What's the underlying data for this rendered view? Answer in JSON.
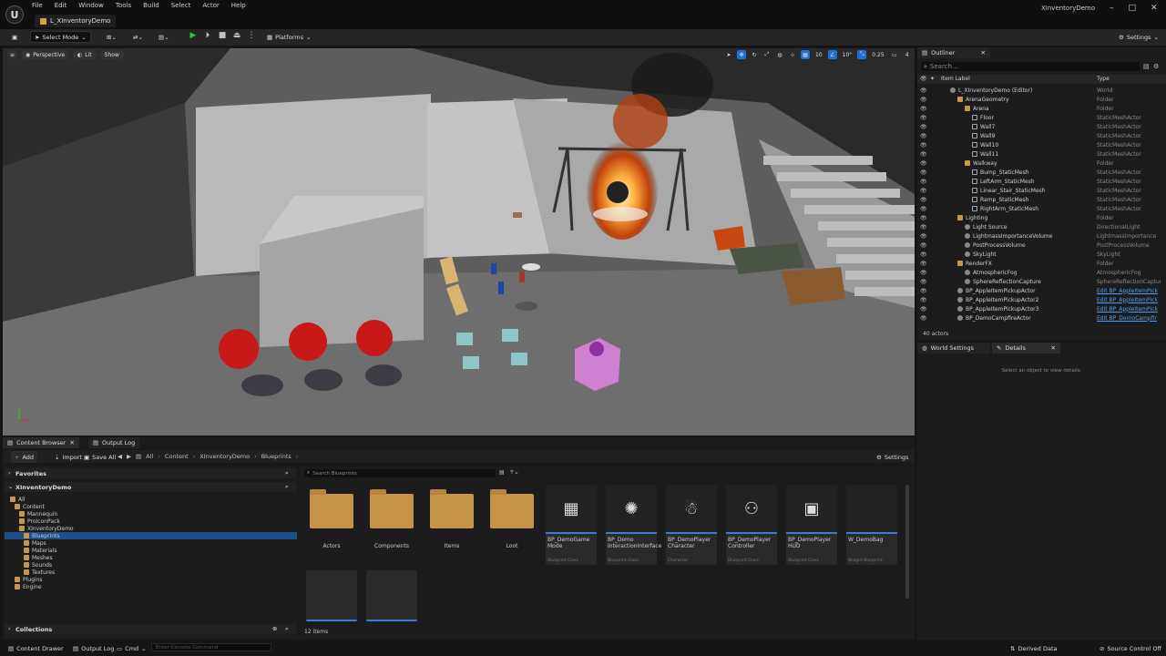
{
  "app": {
    "project": "XInventoryDemo",
    "level_tab": "L_XInventoryDemo"
  },
  "menu": [
    "File",
    "Edit",
    "Window",
    "Tools",
    "Build",
    "Select",
    "Actor",
    "Help"
  ],
  "toolbar": {
    "select_mode": "Select Mode",
    "platforms": "Platforms",
    "settings": "Settings"
  },
  "viewport": {
    "perspective": "Perspective",
    "lit": "Lit",
    "show": "Show",
    "grid_snap": "10",
    "rot_snap": "10°",
    "scale_snap": "0.25",
    "cam_speed": "4"
  },
  "outliner": {
    "tab": "Outliner",
    "search_placeholder": "Search...",
    "col_label": "Item Label",
    "col_type": "Type",
    "rows": [
      {
        "label": "L_XInventoryDemo (Editor)",
        "type": "World",
        "indent": 0,
        "icon": "actor"
      },
      {
        "label": "ArenaGeometry",
        "type": "Folder",
        "indent": 1,
        "icon": "folder"
      },
      {
        "label": "Arena",
        "type": "Folder",
        "indent": 2,
        "icon": "folder"
      },
      {
        "label": "Floor",
        "type": "StaticMeshActor",
        "indent": 3,
        "icon": "mesh"
      },
      {
        "label": "Wall7",
        "type": "StaticMeshActor",
        "indent": 3,
        "icon": "mesh"
      },
      {
        "label": "Wall9",
        "type": "StaticMeshActor",
        "indent": 3,
        "icon": "mesh"
      },
      {
        "label": "Wall10",
        "type": "StaticMeshActor",
        "indent": 3,
        "icon": "mesh"
      },
      {
        "label": "Wall11",
        "type": "StaticMeshActor",
        "indent": 3,
        "icon": "mesh"
      },
      {
        "label": "Walkway",
        "type": "Folder",
        "indent": 2,
        "icon": "folder"
      },
      {
        "label": "Bump_StaticMesh",
        "type": "StaticMeshActor",
        "indent": 3,
        "icon": "mesh"
      },
      {
        "label": "LeftArm_StaticMesh",
        "type": "StaticMeshActor",
        "indent": 3,
        "icon": "mesh"
      },
      {
        "label": "Linear_Stair_StaticMesh",
        "type": "StaticMeshActor",
        "indent": 3,
        "icon": "mesh"
      },
      {
        "label": "Ramp_StaticMesh",
        "type": "StaticMeshActor",
        "indent": 3,
        "icon": "mesh"
      },
      {
        "label": "RightArm_StaticMesh",
        "type": "StaticMeshActor",
        "indent": 3,
        "icon": "mesh"
      },
      {
        "label": "Lighting",
        "type": "Folder",
        "indent": 1,
        "icon": "folder"
      },
      {
        "label": "Light Source",
        "type": "DirectionalLight",
        "indent": 2,
        "icon": "actor"
      },
      {
        "label": "LightmassImportanceVolume",
        "type": "LightmassImportance",
        "indent": 2,
        "icon": "actor"
      },
      {
        "label": "PostProcessVolume",
        "type": "PostProcessVolume",
        "indent": 2,
        "icon": "actor"
      },
      {
        "label": "SkyLight",
        "type": "SkyLight",
        "indent": 2,
        "icon": "actor"
      },
      {
        "label": "RenderFX",
        "type": "Folder",
        "indent": 1,
        "icon": "folder"
      },
      {
        "label": "AtmosphericFog",
        "type": "AtmosphericFog",
        "indent": 2,
        "icon": "actor"
      },
      {
        "label": "SphereReflectionCapture",
        "type": "SphereReflectionCapture",
        "indent": 2,
        "icon": "actor"
      },
      {
        "label": "BP_AppleItemPickupActor",
        "type": "Edit BP_AppleItemPick",
        "indent": 1,
        "icon": "actor",
        "link": true
      },
      {
        "label": "BP_AppleItemPickupActor2",
        "type": "Edit BP_AppleItemPick",
        "indent": 1,
        "icon": "actor",
        "link": true
      },
      {
        "label": "BP_AppleItemPickupActor3",
        "type": "Edit BP_AppleItemPick",
        "indent": 1,
        "icon": "actor",
        "link": true
      },
      {
        "label": "BP_DemoCampfireActor",
        "type": "Edit BP_DemoCampfir",
        "indent": 1,
        "icon": "actor",
        "link": true
      }
    ],
    "count": "40 actors"
  },
  "details": {
    "tab_world": "World Settings",
    "tab_details": "Details",
    "empty": "Select an object to view details."
  },
  "content_browser": {
    "tab": "Content Browser",
    "tab_output": "Output Log",
    "add": "Add",
    "import": "Import",
    "save_all": "Save All",
    "path": [
      "All",
      "Content",
      "XInventoryDemo",
      "Blueprints"
    ],
    "settings": "Settings",
    "favorites": "Favorites",
    "root": "XInventoryDemo",
    "search_placeholder": "Search Blueprints",
    "tree": [
      {
        "label": "All",
        "indent": 0
      },
      {
        "label": "Content",
        "indent": 1
      },
      {
        "label": "Mannequin",
        "indent": 2
      },
      {
        "label": "ProIconPack",
        "indent": 2
      },
      {
        "label": "XInventoryDemo",
        "indent": 2
      },
      {
        "label": "Blueprints",
        "indent": 3,
        "selected": true
      },
      {
        "label": "Maps",
        "indent": 3
      },
      {
        "label": "Materials",
        "indent": 3
      },
      {
        "label": "Meshes",
        "indent": 3
      },
      {
        "label": "Sounds",
        "indent": 3
      },
      {
        "label": "Textures",
        "indent": 3
      },
      {
        "label": "Plugins",
        "indent": 1
      },
      {
        "label": "Engine",
        "indent": 1
      }
    ],
    "folders": [
      "Actors",
      "Components",
      "Items",
      "Loot"
    ],
    "assets": [
      {
        "name": "BP_DemoGame Mode",
        "sub": "Blueprint Class",
        "icon": "gamemode-icon",
        "glyph": "▦"
      },
      {
        "name": "BP_Demo InteractionInterface",
        "sub": "Blueprint Class",
        "icon": "interface-icon",
        "glyph": "✺"
      },
      {
        "name": "BP_DemoPlayer Character",
        "sub": "Character",
        "icon": "character-icon",
        "glyph": "☃"
      },
      {
        "name": "BP_DemoPlayer Controller",
        "sub": "Blueprint Class",
        "icon": "gamepad-icon",
        "glyph": "⚇"
      },
      {
        "name": "BP_DemoPlayer HUD",
        "sub": "Blueprint Class",
        "icon": "hud-icon",
        "glyph": "▣"
      },
      {
        "name": "W_DemoBag",
        "sub": "Widget Blueprint",
        "icon": "widget-icon",
        "glyph": ""
      }
    ],
    "collections": "Collections",
    "item_count": "12 items"
  },
  "statusbar": {
    "content_drawer": "Content Drawer",
    "output_log": "Output Log",
    "cmd": "Cmd",
    "console_placeholder": "Enter Console Command",
    "derived_data": "Derived Data",
    "source_control": "Source Control Off"
  }
}
